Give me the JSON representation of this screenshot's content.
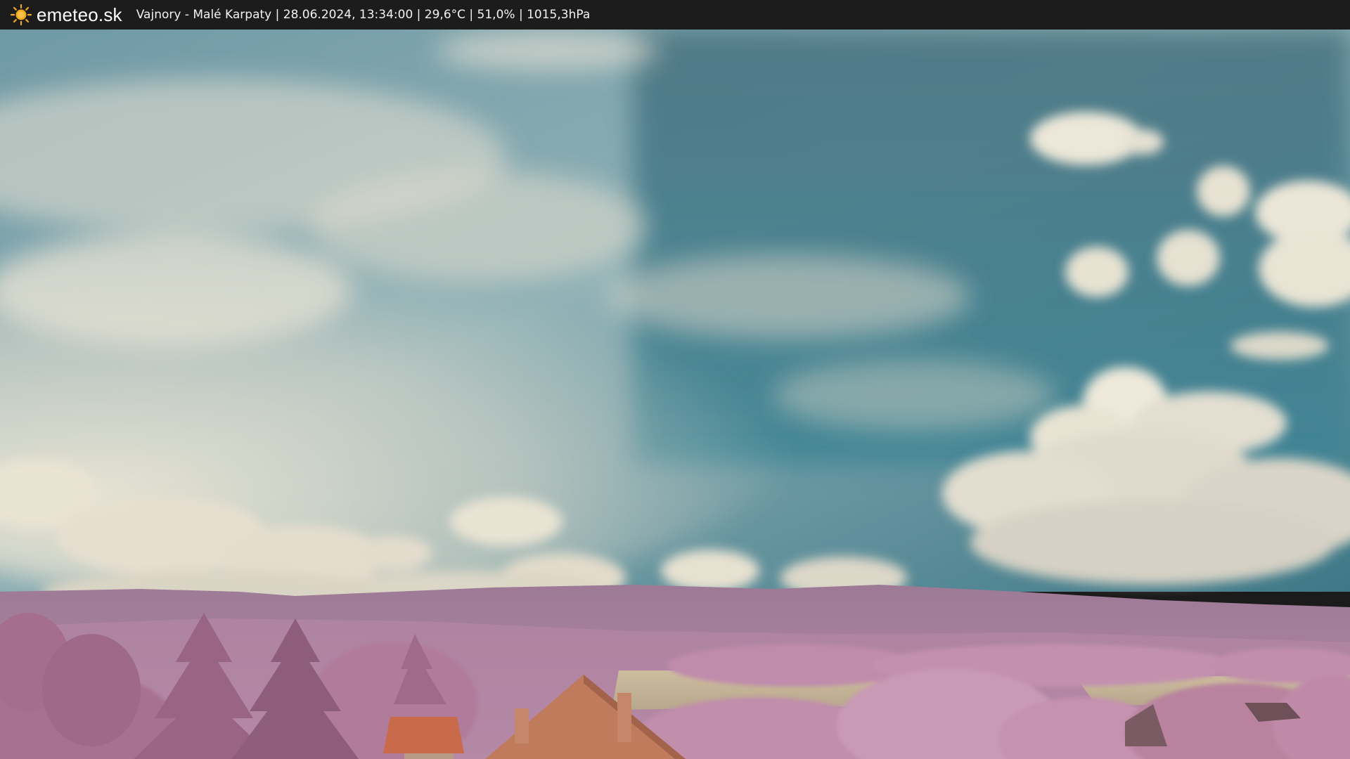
{
  "header": {
    "brand": "emeteo.sk",
    "caption": "Vajnory - Malé Karpaty | 28.06.2024, 13:34:00 | 29,6°C | 51,0% | 1015,3hPa",
    "icon": "sun-icon"
  },
  "colors": {
    "topbar": "#1c1c1c",
    "sun": "#f2a81d",
    "sky_top": "#4e7f8e",
    "sky_teal": "#3f7d8c",
    "cloud": "#e9e3d2",
    "hills": "#a97c9c",
    "foliage": "#b77fa3",
    "roof": "#c96a4a",
    "field": "#c8b89a"
  }
}
